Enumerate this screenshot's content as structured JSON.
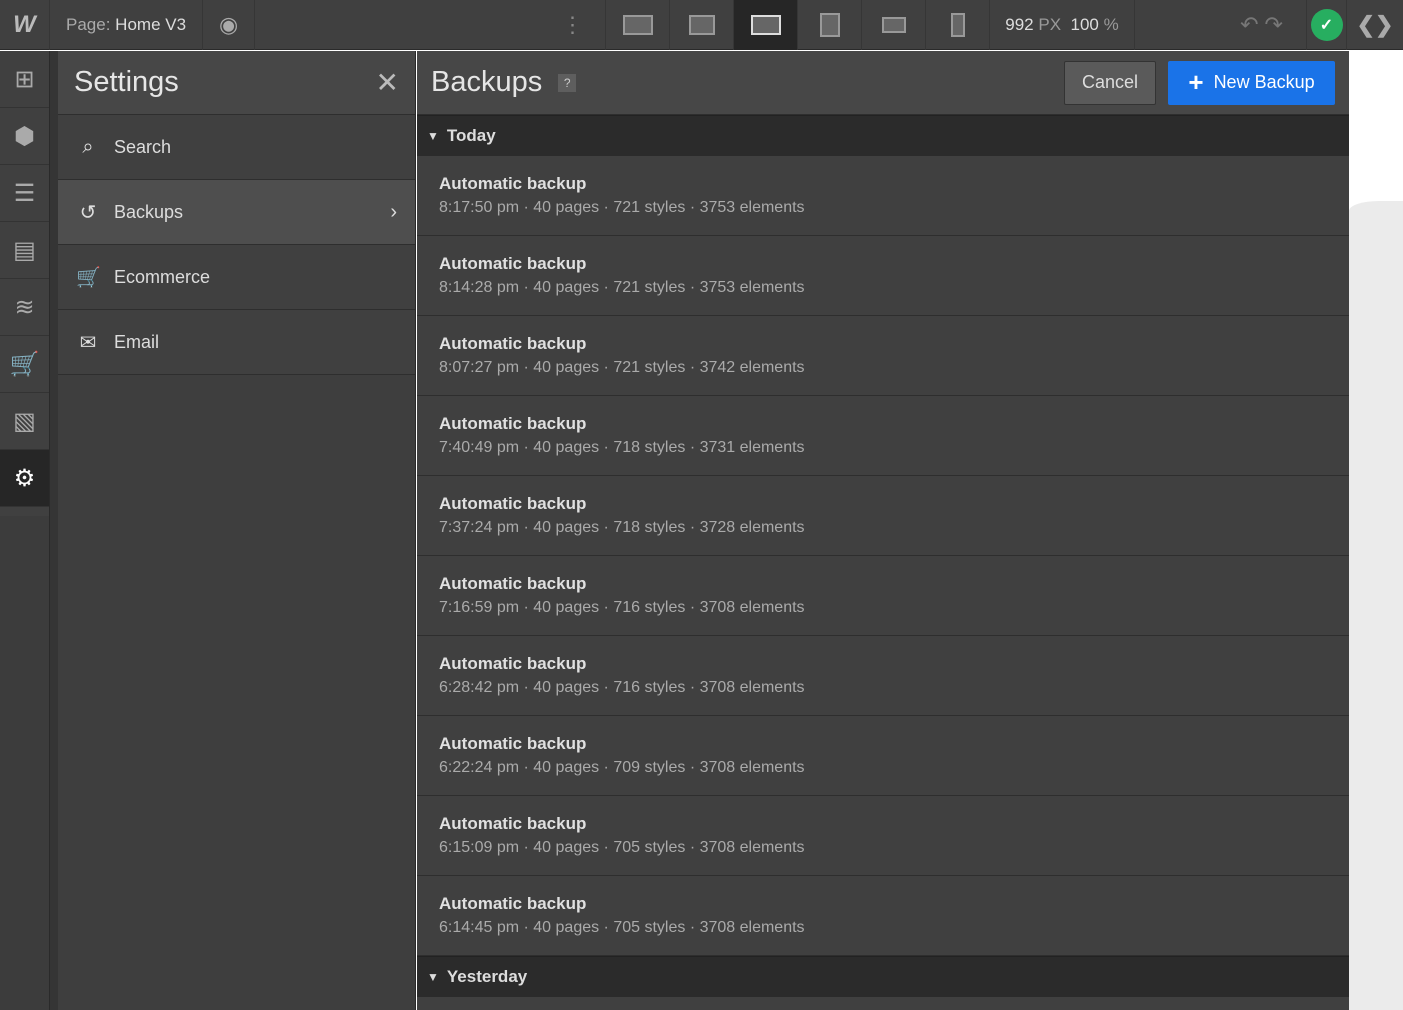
{
  "topbar": {
    "logo": "W",
    "page_label": "Page:",
    "page_name": "Home V3",
    "width_value": "992",
    "width_unit": "PX",
    "zoom_value": "100",
    "zoom_unit": "%",
    "status_color": "#27ae60"
  },
  "settings": {
    "title": "Settings",
    "items": [
      {
        "label": "Search",
        "icon": "search-icon"
      },
      {
        "label": "Backups",
        "icon": "history-icon"
      },
      {
        "label": "Ecommerce",
        "icon": "cart-icon"
      },
      {
        "label": "Email",
        "icon": "mail-icon"
      }
    ]
  },
  "backups": {
    "title": "Backups",
    "help": "?",
    "cancel": "Cancel",
    "new_backup": "New Backup",
    "accent": "#1a73e8",
    "groups": [
      {
        "label": "Today",
        "items": [
          {
            "title": "Automatic backup",
            "detail": "8:17:50 pm · 40 pages · 721 styles · 3753 elements"
          },
          {
            "title": "Automatic backup",
            "detail": "8:14:28 pm · 40 pages · 721 styles · 3753 elements"
          },
          {
            "title": "Automatic backup",
            "detail": "8:07:27 pm · 40 pages · 721 styles · 3742 elements"
          },
          {
            "title": "Automatic backup",
            "detail": "7:40:49 pm · 40 pages · 718 styles · 3731 elements"
          },
          {
            "title": "Automatic backup",
            "detail": "7:37:24 pm · 40 pages · 718 styles · 3728 elements"
          },
          {
            "title": "Automatic backup",
            "detail": "7:16:59 pm · 40 pages · 716 styles · 3708 elements"
          },
          {
            "title": "Automatic backup",
            "detail": "6:28:42 pm · 40 pages · 716 styles · 3708 elements"
          },
          {
            "title": "Automatic backup",
            "detail": "6:22:24 pm · 40 pages · 709 styles · 3708 elements"
          },
          {
            "title": "Automatic backup",
            "detail": "6:15:09 pm · 40 pages · 705 styles · 3708 elements"
          },
          {
            "title": "Automatic backup",
            "detail": "6:14:45 pm · 40 pages · 705 styles · 3708 elements"
          }
        ]
      },
      {
        "label": "Yesterday",
        "items": []
      }
    ]
  }
}
